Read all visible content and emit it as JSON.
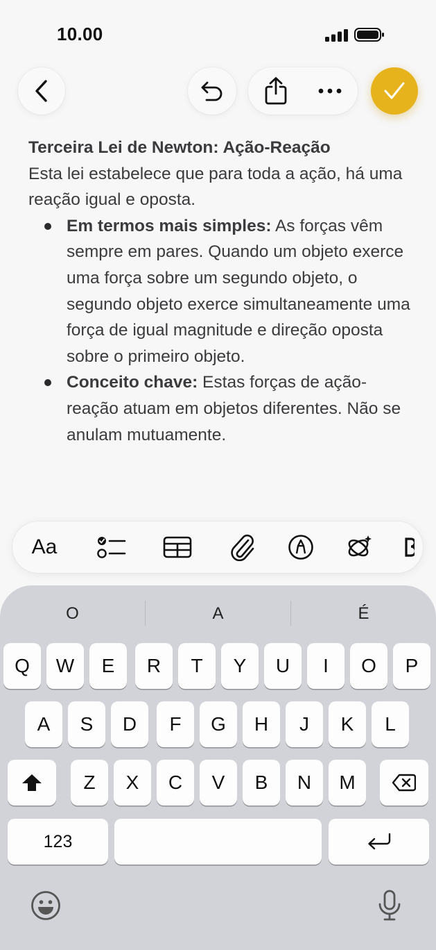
{
  "status": {
    "time": "10.00"
  },
  "note": {
    "title": "Terceira Lei de Newton: Ação-Reação",
    "intro": "Esta lei estabelece que para toda a ação, há uma reação igual e oposta.",
    "bullets": [
      {
        "bold": "Em termos mais simples:",
        "text": " As forças vêm sempre em pares. Quando um objeto exerce uma força sobre um segundo objeto, o segundo objeto exerce simultaneamente uma força de igual magnitude e direção oposta sobre o primeiro objeto."
      },
      {
        "bold": "Conceito chave:",
        "text": " Estas forças de ação-reação atuam em objetos diferentes. Não se anulam mutuamente."
      }
    ]
  },
  "format_bar": {
    "text_style_label": "Aa"
  },
  "keyboard": {
    "suggestions": [
      "O",
      "A",
      "É"
    ],
    "row1": [
      "Q",
      "W",
      "E",
      "R",
      "T",
      "Y",
      "U",
      "I",
      "O",
      "P"
    ],
    "row2": [
      "A",
      "S",
      "D",
      "F",
      "G",
      "H",
      "J",
      "K",
      "L"
    ],
    "row3": [
      "Z",
      "X",
      "C",
      "V",
      "B",
      "N",
      "M"
    ],
    "numbers_label": "123"
  },
  "colors": {
    "accent": "#e7b31c",
    "keyboard_bg": "#d1d3d9",
    "text": "#3b3b3e"
  }
}
